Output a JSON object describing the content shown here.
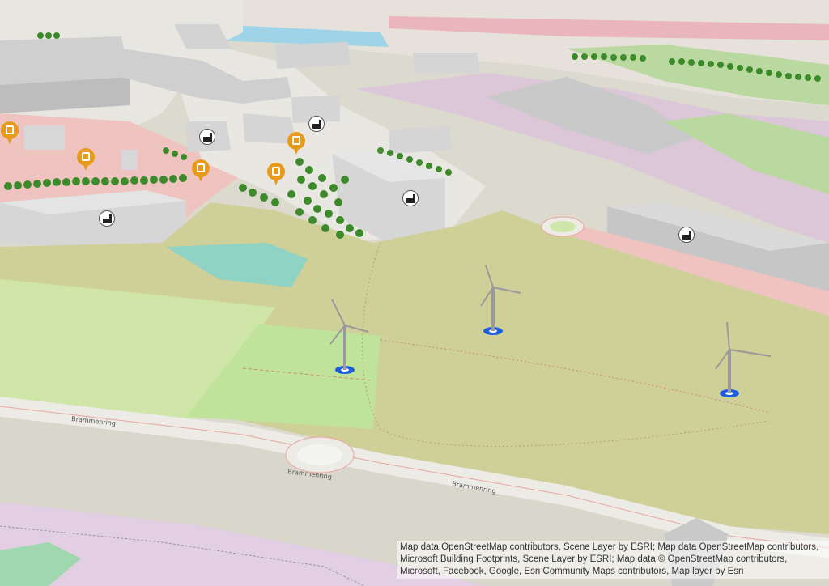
{
  "roads": [
    {
      "label": "Brammenring"
    },
    {
      "label": "Brammenring"
    },
    {
      "label": "Brammenring"
    }
  ],
  "attribution": {
    "text": "Map data OpenStreetMap contributors, Scene Layer by ESRI; Map data OpenStreetMap contributors, Microsoft Building Footprints, Scene Layer by ESRI; Map data © OpenStreetMap contributors, Microsoft, Facebook, Google, Esri Community Maps contributors, Map layer by Esri"
  },
  "colors": {
    "field": "#cfcf98",
    "meadow": "#cfe6a8",
    "water": "#8fd3c4",
    "residential_pink": "#efc3c0",
    "industrial_purple": "#dcc7d8",
    "building": "#d8d8d8",
    "tree": "#3c8a2a",
    "turbine_base": "#1f5de0",
    "charging_pin": "#e89a1c"
  },
  "markers": {
    "wind_turbine_icon": "wind-turbine",
    "factory_icon": "factory",
    "charging_station_icon": "charging-station"
  }
}
